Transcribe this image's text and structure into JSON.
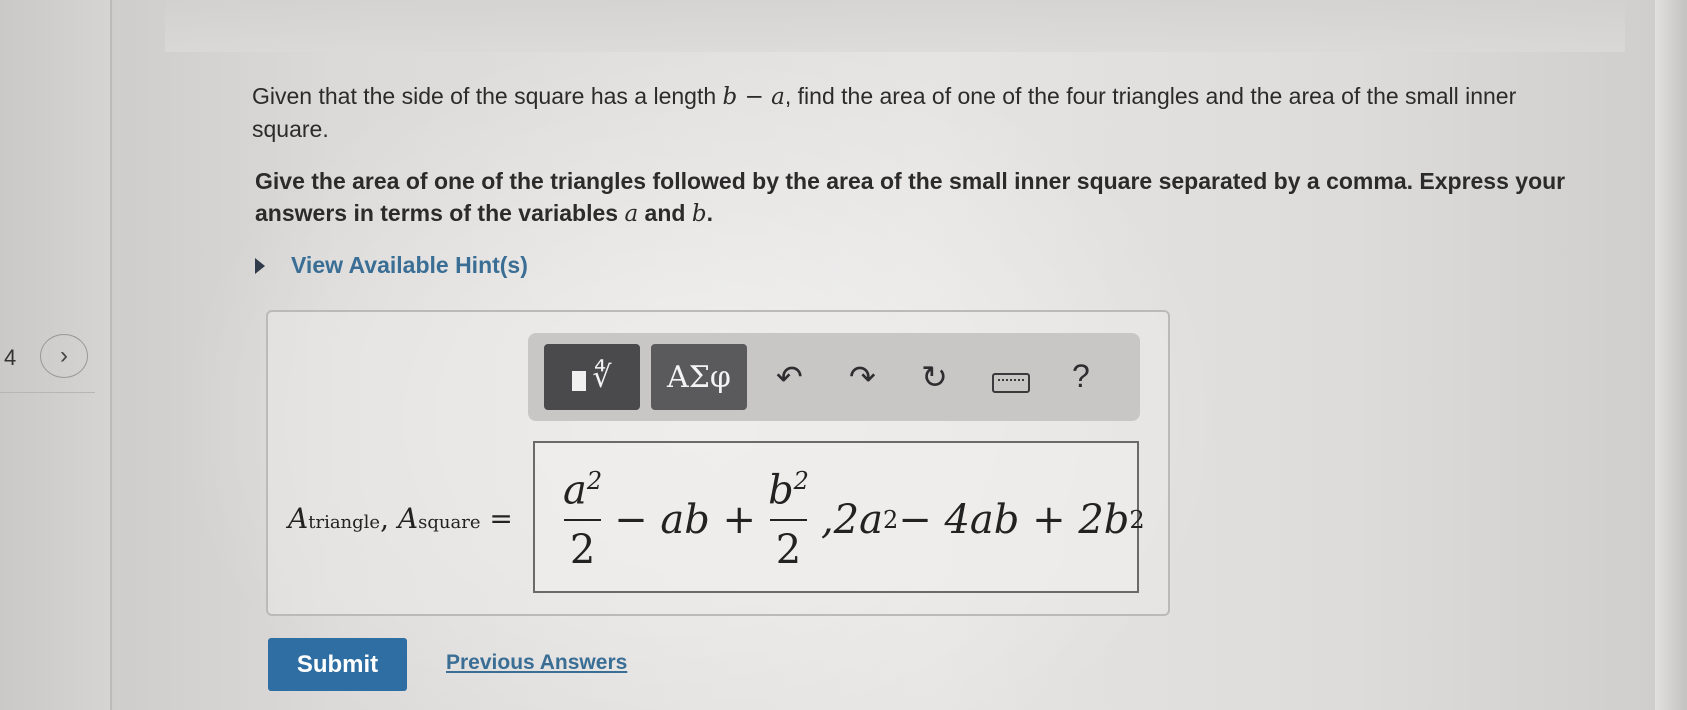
{
  "navigation": {
    "page_number": "4",
    "next_icon": "chevron-right-icon"
  },
  "question": {
    "text_part1": "Given that the side of the square has a length ",
    "expr": "b − a",
    "text_part2": ", find the area of one of the four triangles and the area of the small inner square.",
    "instruction_part1": "Give the area of one of the triangles followed by the area of the small inner square separated by a comma. Express your answers in terms of the variables ",
    "var_a": "a",
    "instruction_and": " and ",
    "var_b": "b",
    "instruction_end": "."
  },
  "hints": {
    "label": "View Available Hint(s)",
    "icon": "caret-right-icon"
  },
  "toolbar": {
    "templates_icon": "templates-icon",
    "templates_glyph": "∜",
    "symbols_label": "ΑΣφ",
    "undo_glyph": "↶",
    "redo_glyph": "↷",
    "reset_glyph": "↻",
    "keyboard_icon": "keyboard-icon",
    "help_label": "?"
  },
  "answer": {
    "label_A": "A",
    "label_sub1": "triangle",
    "label_sep": ", ",
    "label_A2": "A",
    "label_sub2": "square",
    "label_eq": " = ",
    "frac1_num_base": "a",
    "frac1_num_exp": "2",
    "frac1_den": "2",
    "mid": " − ab + ",
    "frac2_num_base": "b",
    "frac2_num_exp": "2",
    "frac2_den": "2",
    "tail_part1": ",2a",
    "tail_exp1": "2",
    "tail_part2": " − 4ab + 2b",
    "tail_exp2": "2"
  },
  "footer": {
    "submit_label": "Submit",
    "previous_answers_label": "Previous Answers"
  },
  "colors": {
    "link": "#3a6e95",
    "submit_bg": "#2f6ea2",
    "toolbar_dark_button": "#4a4a4c"
  }
}
